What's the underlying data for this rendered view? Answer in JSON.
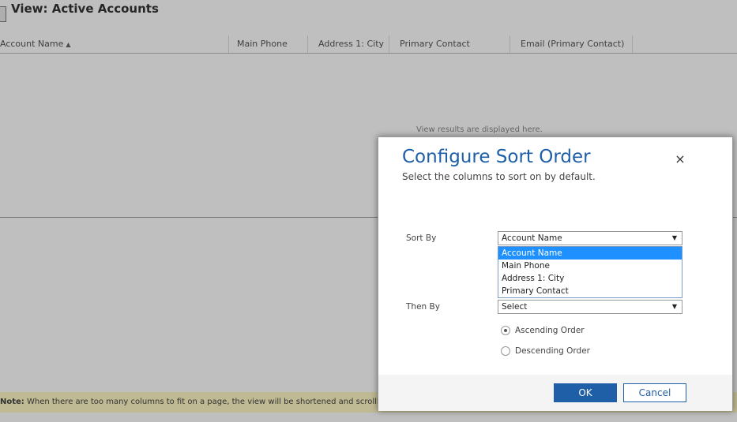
{
  "view": {
    "title": "View: Active Accounts",
    "columns": [
      {
        "label": "Account Name",
        "sort_indicator": "▲"
      },
      {
        "label": "Main Phone"
      },
      {
        "label": "Address 1: City"
      },
      {
        "label": "Primary Contact"
      },
      {
        "label": "Email (Primary Contact)"
      }
    ],
    "empty_message": "View results are displayed here.",
    "note_label": "Note:",
    "note_text": " When there are too many columns to fit on a page, the view will be shortened and scrollbars"
  },
  "dialog": {
    "title": "Configure Sort Order",
    "subtitle": "Select the columns to sort on by default.",
    "close_glyph": "×",
    "sort_by_label": "Sort By",
    "sort_by_value": "Account Name",
    "sort_by_options": [
      "Account Name",
      "Main Phone",
      "Address 1: City",
      "Primary Contact"
    ],
    "sort_by_selected_index": 0,
    "then_by_label": "Then By",
    "then_by_value": "Select",
    "caret_glyph": "▼",
    "ascending_label": "Ascending Order",
    "descending_label": "Descending Order",
    "order_selected": "ascending",
    "ok_label": "OK",
    "cancel_label": "Cancel"
  },
  "colors": {
    "accent": "#1f5fa8",
    "dropdown_highlight": "#1e90ff",
    "note_background": "#fff8c4"
  }
}
